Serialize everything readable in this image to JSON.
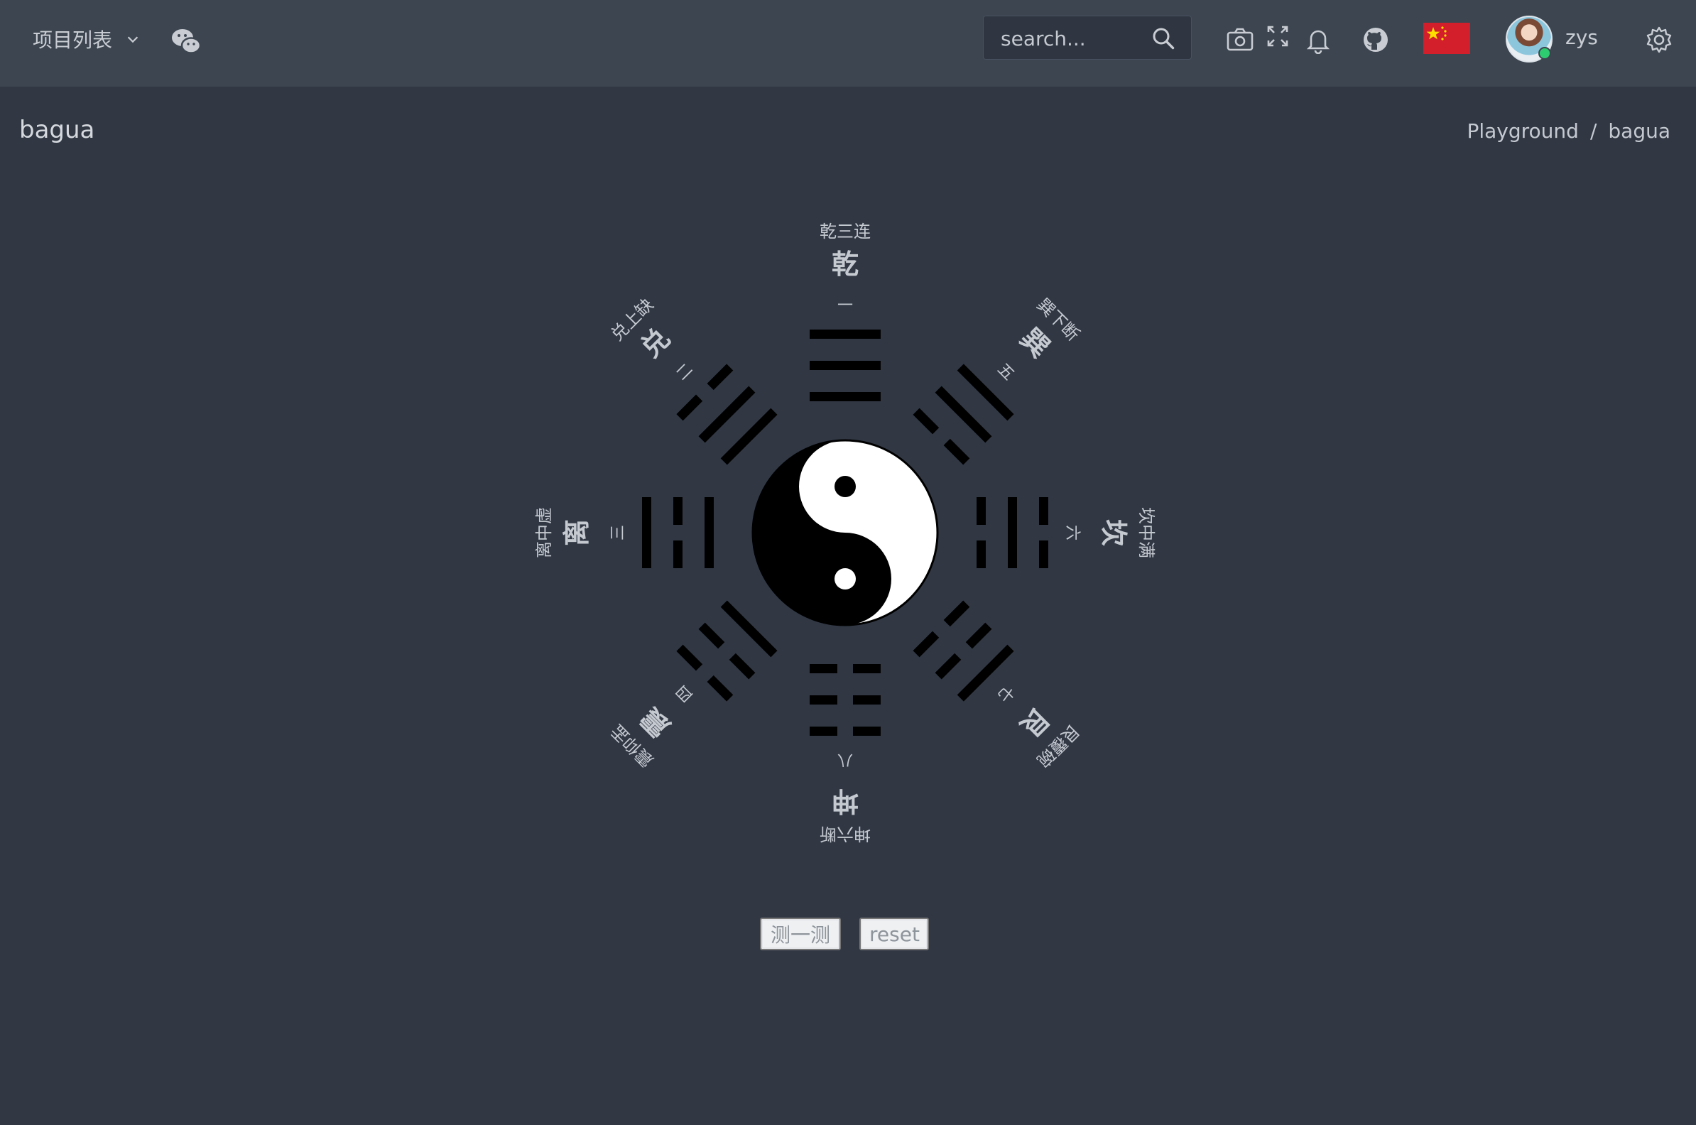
{
  "topbar": {
    "project_menu_label": "项目列表",
    "search_placeholder": "search...",
    "username": "zys"
  },
  "page": {
    "title": "bagua",
    "breadcrumb": [
      "Playground",
      "bagua"
    ]
  },
  "bagua": {
    "trigrams": [
      {
        "name": "乾",
        "desc": "乾三连",
        "number": "一",
        "lines": [
          1,
          1,
          1
        ]
      },
      {
        "name": "巽",
        "desc": "巽下断",
        "number": "五",
        "lines": [
          0,
          1,
          1
        ]
      },
      {
        "name": "坎",
        "desc": "坎中满",
        "number": "六",
        "lines": [
          0,
          1,
          0
        ]
      },
      {
        "name": "艮",
        "desc": "艮覆碗",
        "number": "七",
        "lines": [
          0,
          0,
          1
        ]
      },
      {
        "name": "坤",
        "desc": "坤六断",
        "number": "八",
        "lines": [
          0,
          0,
          0
        ]
      },
      {
        "name": "震",
        "desc": "震仰盂",
        "number": "四",
        "lines": [
          1,
          0,
          0
        ]
      },
      {
        "name": "离",
        "desc": "离中虚",
        "number": "三",
        "lines": [
          1,
          0,
          1
        ]
      },
      {
        "name": "兑",
        "desc": "兑上缺",
        "number": "二",
        "lines": [
          1,
          1,
          0
        ]
      }
    ]
  },
  "actions": {
    "test_label": "测一测",
    "reset_label": "reset"
  },
  "colors": {
    "background": "#313844",
    "topbar": "#3c4550",
    "label_text": "#c5c9d0",
    "trigram": "#000000",
    "flag_red": "#d21f2b"
  }
}
